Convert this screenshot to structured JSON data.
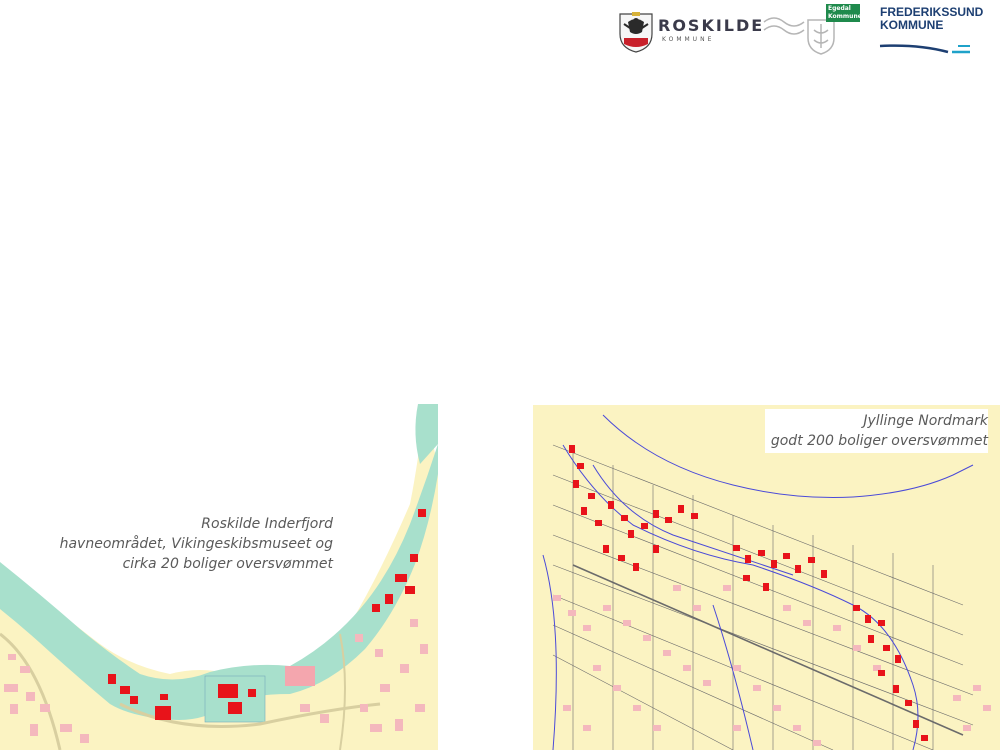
{
  "logos": {
    "roskilde": {
      "name": "ROSKILDE",
      "sub": "KOMMUNE"
    },
    "egedal": {
      "badge_line1": "Egedal",
      "badge_line2": "Kommune"
    },
    "frederikssund": {
      "line1": "FREDERIKSSUND",
      "line2": "KOMMUNE"
    }
  },
  "maps": {
    "left": {
      "caption_line1": "Roskilde Inderfjord",
      "caption_line2": "havneområdet, Vikingeskibsmuseet og",
      "caption_line3": "cirka 20 boliger oversvømmet"
    },
    "right": {
      "caption_line1": "Jyllinge Nordmark",
      "caption_line2": "godt 200 boliger oversvømmet"
    }
  },
  "colors": {
    "land": "#fbf3c2",
    "water": "#ffffff",
    "flood": "#a8e0cc",
    "flooded_building": "#e8131a",
    "building": "#f4b8bd",
    "stream": "#4a4ad8",
    "parcel_line": "#6b6b6b"
  }
}
